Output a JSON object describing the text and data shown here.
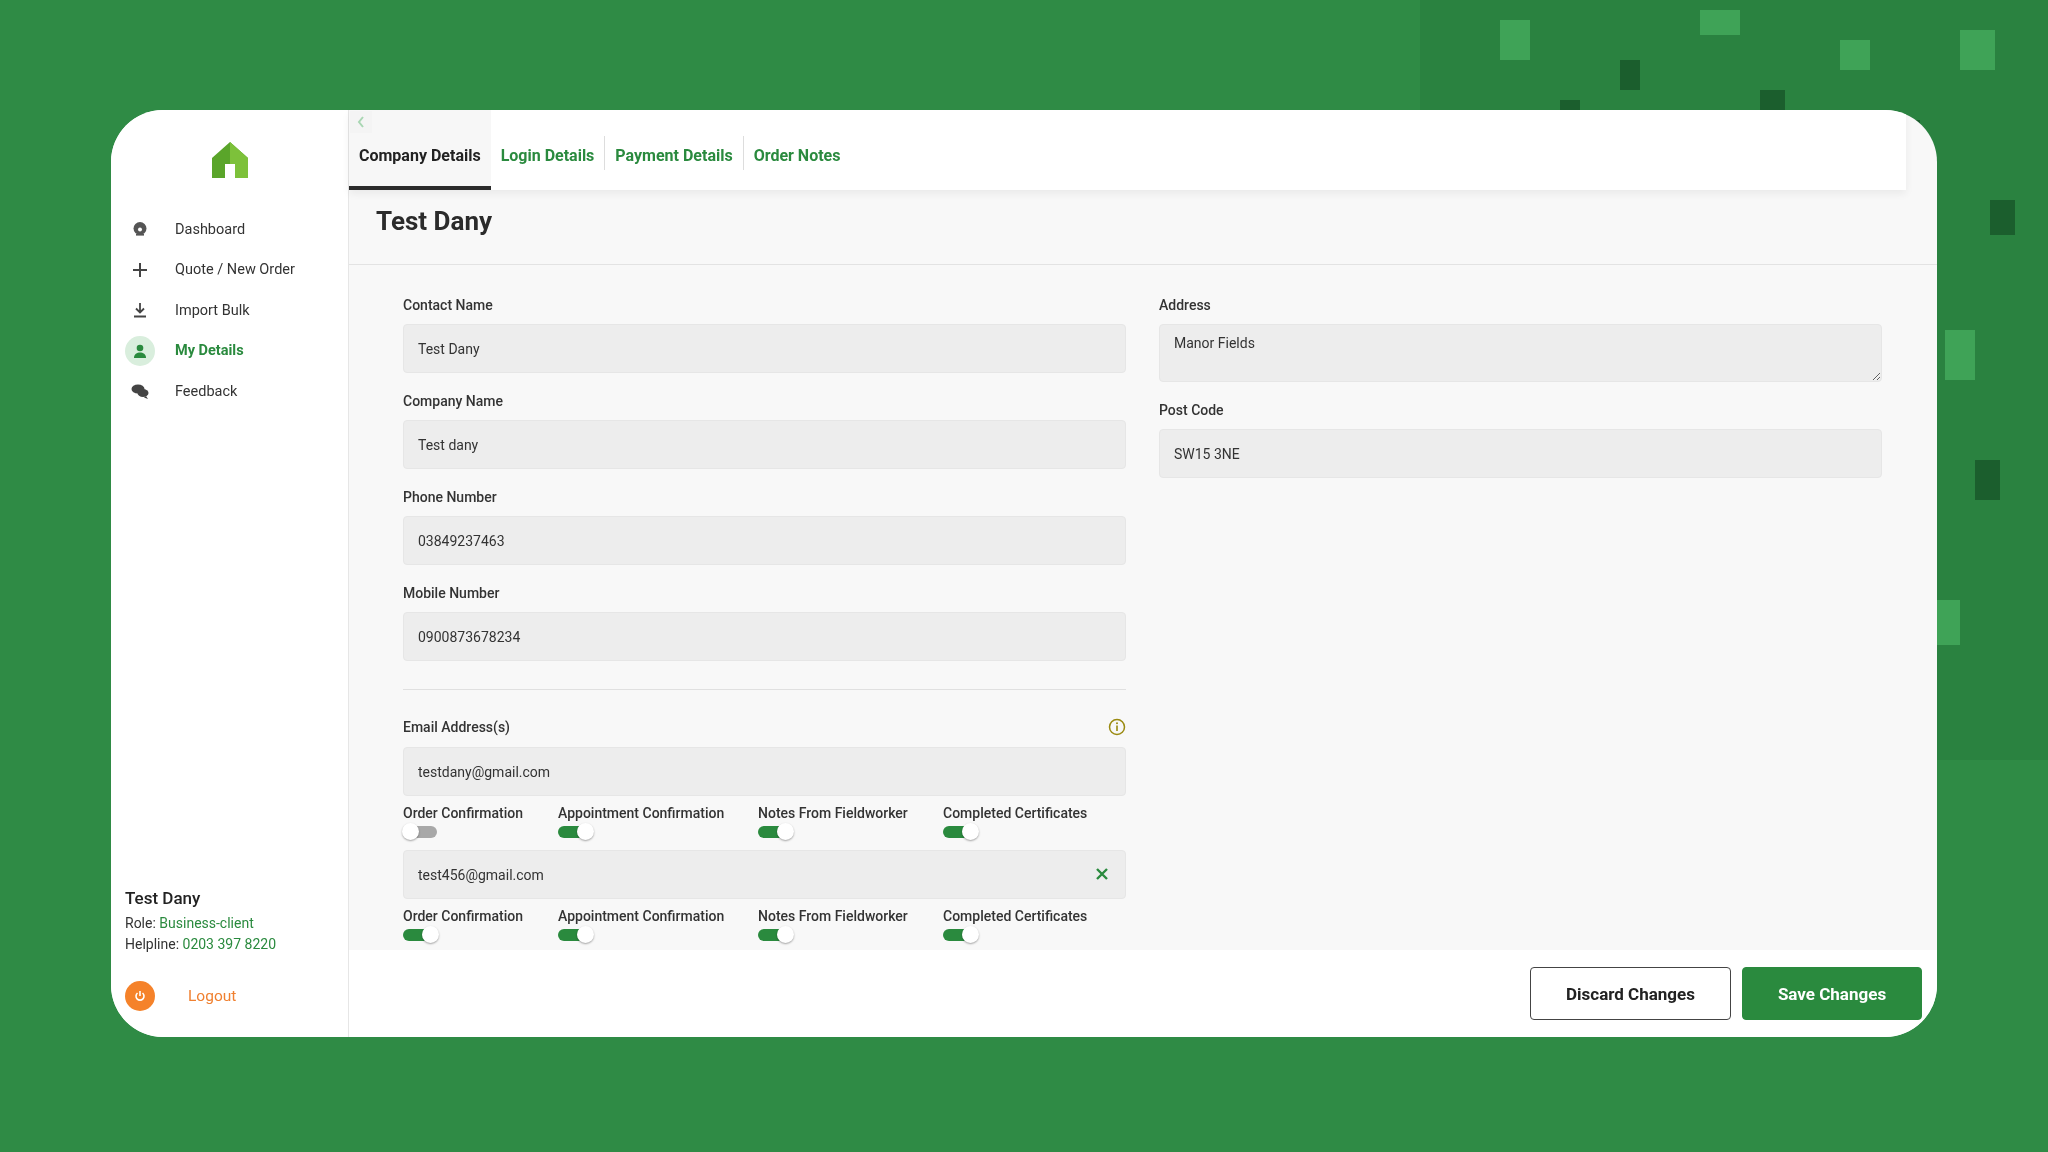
{
  "sidebar": {
    "items": [
      {
        "label": "Dashboard",
        "selected": false
      },
      {
        "label": "Quote / New Order",
        "selected": false
      },
      {
        "label": "Import Bulk",
        "selected": false
      },
      {
        "label": "My Details",
        "selected": true
      },
      {
        "label": "Feedback",
        "selected": false
      }
    ],
    "user": {
      "name": "Test Dany",
      "role_label": "Role:",
      "role": "Business-client",
      "helpline_label": "Helpline:",
      "helpline": "0203 397 8220"
    },
    "logout": "Logout"
  },
  "tabs": [
    {
      "label": "Company Details",
      "selected": true
    },
    {
      "label": "Login Details",
      "selected": false
    },
    {
      "label": "Payment Details",
      "selected": false
    },
    {
      "label": "Order Notes",
      "selected": false
    }
  ],
  "page_title": "Test Dany",
  "fields_left": [
    {
      "label": "Contact Name",
      "value": "Test Dany"
    },
    {
      "label": "Company Name",
      "value": "Test dany"
    },
    {
      "label": "Phone Number",
      "value": "03849237463"
    },
    {
      "label": "Mobile Number",
      "value": "0900873678234"
    }
  ],
  "fields_right": [
    {
      "label": "Address",
      "value": "Manor Fields",
      "kind": "textarea"
    },
    {
      "label": "Post Code",
      "value": "SW15 3NE",
      "kind": "input"
    }
  ],
  "emails": {
    "label": "Email Address(s)",
    "entries": [
      {
        "value": "testdany@gmail.com",
        "removable": false,
        "notifications": [
          {
            "label": "Order Confirmation",
            "on": false
          },
          {
            "label": "Appointment Confirmation",
            "on": true
          },
          {
            "label": "Notes From Fieldworker",
            "on": true
          },
          {
            "label": "Completed Certificates",
            "on": true
          }
        ]
      },
      {
        "value": "test456@gmail.com",
        "removable": true,
        "notifications": [
          {
            "label": "Order Confirmation",
            "on": true
          },
          {
            "label": "Appointment Confirmation",
            "on": true
          },
          {
            "label": "Notes From Fieldworker",
            "on": true
          },
          {
            "label": "Completed Certificates",
            "on": true
          }
        ]
      }
    ]
  },
  "buttons": [
    {
      "label": "Discard Changes",
      "kind": "secondary"
    },
    {
      "label": "Save Changes",
      "kind": "primary"
    }
  ]
}
